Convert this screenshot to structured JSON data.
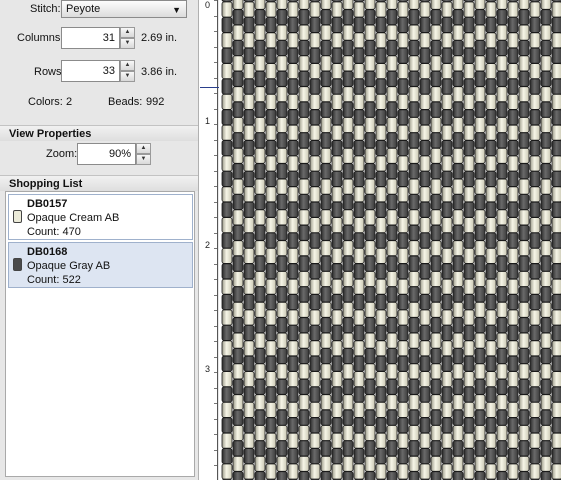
{
  "stitch": {
    "label": "Stitch:",
    "value": "Peyote"
  },
  "columns": {
    "label": "Columns:",
    "value": "31",
    "size": "2.69 in."
  },
  "rows": {
    "label": "Rows:",
    "value": "33",
    "size": "3.86 in."
  },
  "stats": {
    "colors_label": "Colors:",
    "colors_value": "2",
    "beads_label": "Beads:",
    "beads_value": "992"
  },
  "view_properties": {
    "title": "View Properties",
    "zoom_label": "Zoom:",
    "zoom_value": "90%"
  },
  "shopping_list": {
    "title": "Shopping List",
    "items": [
      {
        "code": "DB0157",
        "name": "Opaque Cream AB",
        "count": "Count: 470",
        "color": "#ecebd9",
        "selected": false
      },
      {
        "code": "DB0168",
        "name": "Opaque Gray AB",
        "count": "Count: 522",
        "color": "#4a4a4a",
        "selected": true
      }
    ]
  },
  "ruler": {
    "labels": [
      "0",
      "1",
      "2",
      "3"
    ]
  },
  "colors": {
    "cream": "#ecebd9",
    "gray": "#4a4a4a",
    "selection": "#dde5f2",
    "marker": "#2a3f8c"
  }
}
